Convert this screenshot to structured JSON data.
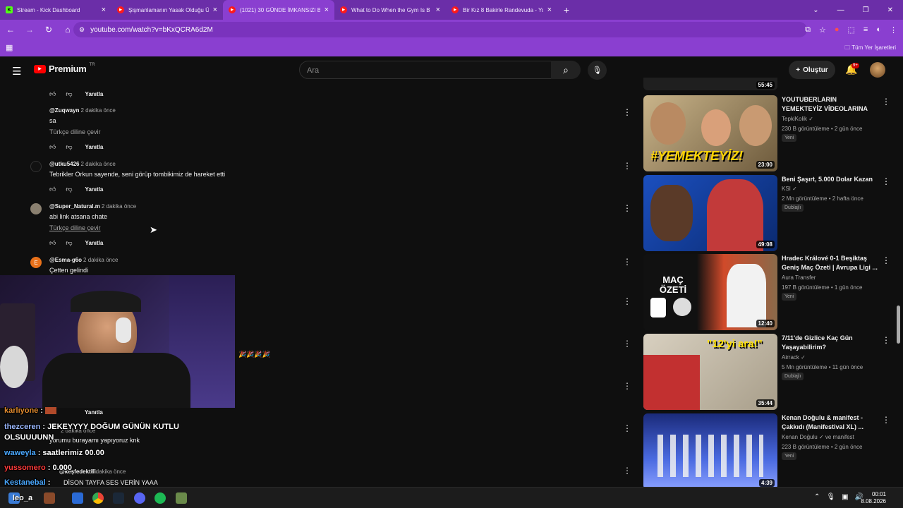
{
  "browser": {
    "tabs": [
      {
        "title": "Stream - Kick Dashboard",
        "favicon": "kick-icon",
        "active": false
      },
      {
        "title": "Şişmanlamanın Yasak Olduğu Ü",
        "favicon": "youtube-icon",
        "active": false
      },
      {
        "title": "(1021) 30 GÜNDE İMKANSIZI B",
        "favicon": "youtube-icon",
        "active": true
      },
      {
        "title": "What to Do When the Gym Is B",
        "favicon": "youtube-icon",
        "active": false
      },
      {
        "title": "Bir Kız 8 Bakirle Randevuda - Yo",
        "favicon": "youtube-icon",
        "active": false
      }
    ],
    "url": "youtube.com/watch?v=bKxQCRA6d2M",
    "bookmarks_all": "Tüm Yer İşaretleri"
  },
  "youtube": {
    "logo_text": "Premium",
    "region": "TR",
    "search_placeholder": "Ara",
    "create_label": "Oluştur",
    "notif_count": "9+"
  },
  "comments": [
    {
      "user": "",
      "time": "",
      "text": "",
      "translate": "",
      "reply": "Yanıtla",
      "actions_only": true
    },
    {
      "user": "@Zuqwayn",
      "time": "2 dakika önce",
      "text": "sa",
      "translate": "Türkçe diline çevir",
      "reply": "Yanıtla"
    },
    {
      "user": "@utku5426",
      "time": "2 dakika önce",
      "text": "Tebrikler Orkun sayende, seni görüp tombikimiz de hareket etti",
      "translate": "",
      "reply": "Yanıtla"
    },
    {
      "user": "@Super_Natural.m",
      "time": "2 dakika önce",
      "text": "abi link atsana chate",
      "translate": "Türkçe diline çevir",
      "reply": "Yanıtla"
    },
    {
      "user": "@Esma-g6o",
      "time": "2 dakika önce",
      "text": "Çetten gelindi",
      "translate": "",
      "reply": "Yanıtla",
      "avatar_letter": "E"
    },
    {
      "user": "@...",
      "time": "2 dakika önce",
      "text": "yorumu burayamı yapıyoruz knk",
      "reply": "Yanıtla"
    },
    {
      "user": "@keşfedektifi",
      "time": "2 dakika önce",
      "text": "DİSON TAYFA SES VERİN YAAA"
    }
  ],
  "stream_chat": [
    {
      "user": "karlıyone",
      "msg": "",
      "color": "#e08a2e"
    },
    {
      "user": "thezceren",
      "msg": "JEKEYYYY DOĞUM GÜNÜN KUTLU OLSUUUUNN",
      "color": "#9ab8ff"
    },
    {
      "user": "waweyla",
      "msg": "saatlerimiz 00.00",
      "color": "#4aa8ff"
    },
    {
      "user": "yussomero",
      "msg": "0.000",
      "color": "#ff3b3b"
    },
    {
      "user": "Kestanebal",
      "msg": "",
      "color": "#4aa8ff"
    }
  ],
  "recommended": [
    {
      "title": "",
      "duration": "55:45"
    },
    {
      "title": "YOUTUBERLARIN YEMEKTEYİZ VİDEOLARINA TEPKİ!",
      "channel": "TepkiKolik",
      "meta": "230 B görüntüleme • 2 gün önce",
      "tag": "Yeni",
      "duration": "23:00"
    },
    {
      "title": "Beni Şaşırt, 5.000 Dolar Kazan",
      "channel": "KSI",
      "meta": "2 Mn görüntüleme • 2 hafta önce",
      "tag": "Dublajlı",
      "duration": "49:08"
    },
    {
      "title": "Hradec Králové 0-1 Beşiktaş Geniş Maç Özeti | Avrupa Ligi ...",
      "channel": "Aura Transfer",
      "meta": "197 B görüntüleme • 1 gün önce",
      "tag": "Yeni",
      "duration": "12:40"
    },
    {
      "title": "7/11'de Gizlice Kaç Gün Yaşayabilirim?",
      "channel": "Airrack",
      "meta": "5 Mn görüntüleme • 11 gün önce",
      "tag": "Dublajlı",
      "duration": "35:44"
    },
    {
      "title": "Kenan Doğulu & manifest - Çakkıdı (Manifestival XL) ...",
      "channel": "Kenan Doğulu ✓ ve manifest",
      "meta": "223 B görüntüleme • 2 gün önce",
      "tag": "Yeni",
      "duration": "4:39"
    }
  ],
  "thumb_text": {
    "yemekteyiz": "#YEMEKTEYİZ!",
    "mac": "MAÇ ÖZETİ",
    "ara": "\"12'yi ara!\""
  },
  "taskbar": {
    "time": "00:01",
    "date": "8.08.2026",
    "user_label": "leo_a"
  }
}
